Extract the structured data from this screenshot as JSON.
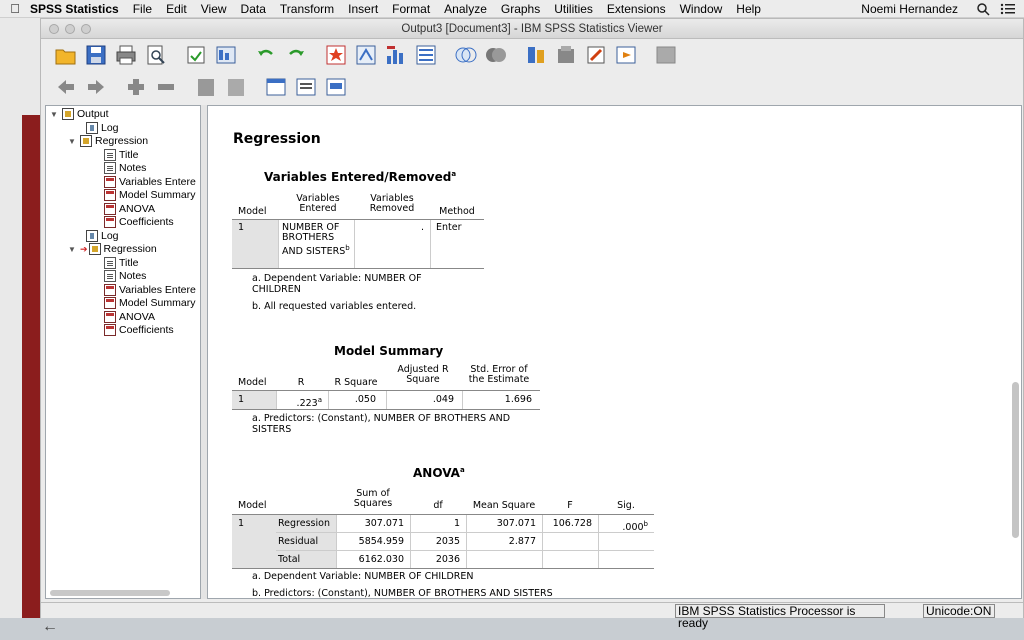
{
  "menubar": {
    "app": "SPSS Statistics",
    "items": [
      "File",
      "Edit",
      "View",
      "Data",
      "Transform",
      "Insert",
      "Format",
      "Analyze",
      "Graphs",
      "Utilities",
      "Extensions",
      "Window",
      "Help"
    ],
    "user": "Noemi Hernandez"
  },
  "window": {
    "title": "Output3 [Document3] - IBM SPSS Statistics Viewer"
  },
  "outline": {
    "root": "Output",
    "log1": "Log",
    "regression1": "Regression",
    "r1_items": [
      "Title",
      "Notes",
      "Variables Entere",
      "Model Summary",
      "ANOVA",
      "Coefficients"
    ],
    "log2": "Log",
    "regression2": "Regression",
    "r2_items": [
      "Title",
      "Notes",
      "Variables Entere",
      "Model Summary",
      "ANOVA",
      "Coefficients"
    ]
  },
  "output": {
    "heading": "Regression",
    "ver": {
      "title": "Variables Entered/Removed",
      "title_sup": "a",
      "col_model": "Model",
      "col_entered": [
        "Variables",
        "Entered"
      ],
      "col_removed": [
        "Variables",
        "Removed"
      ],
      "col_method": "Method",
      "row_model": "1",
      "row_entered": [
        "NUMBER OF",
        "BROTHERS",
        "AND SISTERS"
      ],
      "row_entered_sup": "b",
      "row_removed": ".",
      "row_method": "Enter",
      "note_a": [
        "a. Dependent Variable: NUMBER OF",
        "CHILDREN"
      ],
      "note_b": "b. All requested variables entered."
    },
    "ms": {
      "title": "Model Summary",
      "col_model": "Model",
      "col_r": "R",
      "col_r2": "R Square",
      "col_adj": [
        "Adjusted R",
        "Square"
      ],
      "col_se": [
        "Std. Error of",
        "the Estimate"
      ],
      "row_model": "1",
      "row_r": ".223",
      "row_r_sup": "a",
      "row_r2": ".050",
      "row_adj": ".049",
      "row_se": "1.696",
      "note_a": [
        "a. Predictors: (Constant), NUMBER OF BROTHERS AND",
        "SISTERS"
      ]
    },
    "anova": {
      "title": "ANOVA",
      "title_sup": "a",
      "col_model": "Model",
      "col_ss": [
        "Sum of",
        "Squares"
      ],
      "col_df": "df",
      "col_ms": "Mean Square",
      "col_f": "F",
      "col_sig": "Sig.",
      "model_num": "1",
      "rows": [
        {
          "label": "Regression",
          "ss": "307.071",
          "df": "1",
          "ms": "307.071",
          "f": "106.728",
          "sig": ".000",
          "sig_sup": "b"
        },
        {
          "label": "Residual",
          "ss": "5854.959",
          "df": "2035",
          "ms": "2.877",
          "f": "",
          "sig": "",
          "sig_sup": ""
        },
        {
          "label": "Total",
          "ss": "6162.030",
          "df": "2036",
          "ms": "",
          "f": "",
          "sig": "",
          "sig_sup": ""
        }
      ],
      "note_a": "a. Dependent Variable: NUMBER OF CHILDREN",
      "note_b": "b. Predictors: (Constant), NUMBER OF BROTHERS AND SISTERS"
    }
  },
  "status": {
    "processor": "IBM SPSS Statistics Processor is ready",
    "unicode": "Unicode:ON"
  },
  "icons": {
    "toolbar1": [
      "open-folder-icon",
      "save-icon",
      "print-icon",
      "print-preview-icon",
      "export-icon",
      "recall-dialog-icon",
      "undo-icon",
      "redo-icon",
      "goto-data-icon",
      "goto-case-icon",
      "variables-icon",
      "split-file-icon",
      "select-cases-icon",
      "value-labels-icon",
      "use-sets-icon",
      "insert-output-icon",
      "edit-icon",
      "designate-window-icon"
    ],
    "toolbar2": [
      "back-icon",
      "forward-icon",
      "expand-icon",
      "collapse-icon",
      "show-icon",
      "hide-icon",
      "insert-heading-icon",
      "insert-title-icon",
      "insert-text-icon"
    ]
  }
}
